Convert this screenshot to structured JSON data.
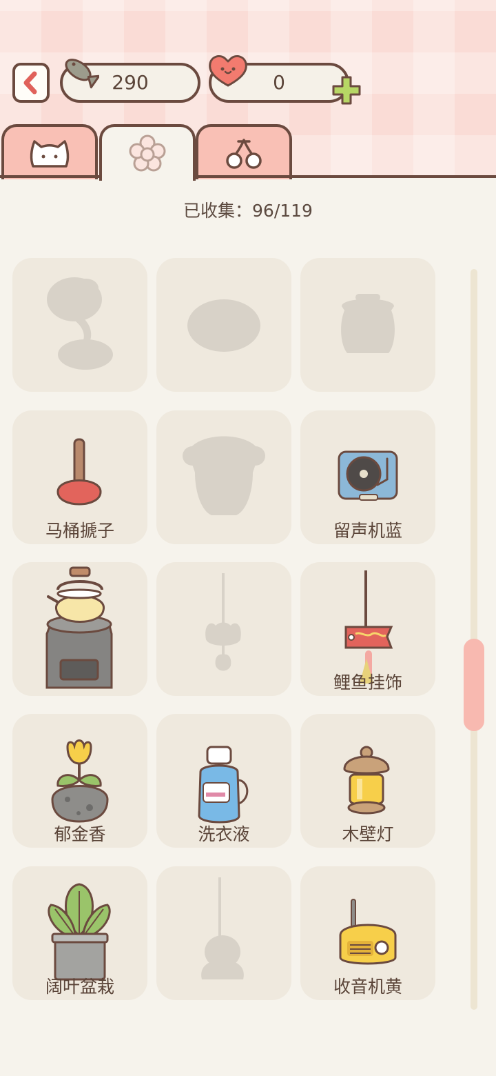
{
  "header": {
    "fish_count": "290",
    "heart_count": "0"
  },
  "tabs": [
    {
      "icon": "cat-face-icon",
      "active": false
    },
    {
      "icon": "flower-icon",
      "active": true
    },
    {
      "icon": "cherry-icon",
      "active": false
    }
  ],
  "collection": {
    "collected_text": "已收集：96/119"
  },
  "items": [
    {
      "label": "",
      "locked": true
    },
    {
      "label": "",
      "locked": true
    },
    {
      "label": "",
      "locked": true
    },
    {
      "label": "马桶搋子",
      "locked": false
    },
    {
      "label": "",
      "locked": true
    },
    {
      "label": "留声机蓝",
      "locked": false
    },
    {
      "label": "",
      "locked": false
    },
    {
      "label": "",
      "locked": true
    },
    {
      "label": "鲤鱼挂饰",
      "locked": false
    },
    {
      "label": "郁金香",
      "locked": false
    },
    {
      "label": "洗衣液",
      "locked": false
    },
    {
      "label": "木壁灯",
      "locked": false
    },
    {
      "label": "阔叶盆栽",
      "locked": false
    },
    {
      "label": "",
      "locked": true
    },
    {
      "label": "收音机黄",
      "locked": false
    }
  ],
  "colors": {
    "header_bg": "#fadcd6",
    "page_bg": "#f6f3ec",
    "cell_bg": "#efe9de",
    "outline": "#6b4a3f",
    "tab_inactive": "#f9c0b5",
    "scroll_thumb": "#f8b9b0"
  }
}
